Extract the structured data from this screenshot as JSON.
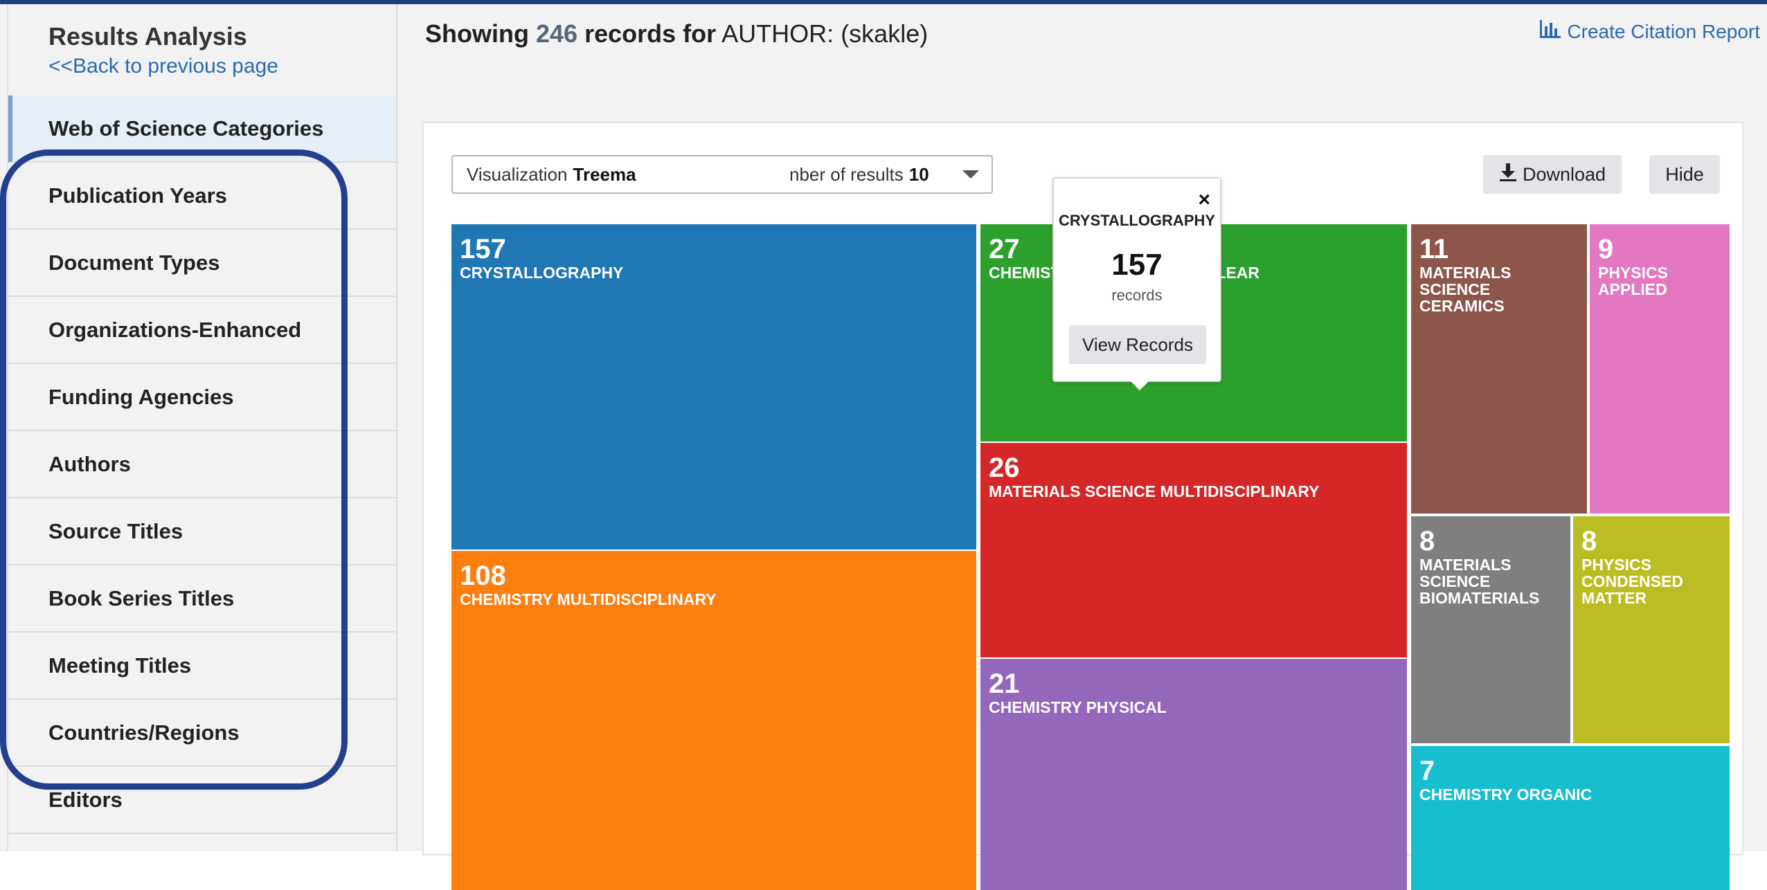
{
  "sidebar": {
    "title": "Results Analysis",
    "back_link": "<<Back to previous page",
    "items": [
      {
        "label": "Web of Science Categories"
      },
      {
        "label": "Publication Years"
      },
      {
        "label": "Document Types"
      },
      {
        "label": "Organizations-Enhanced"
      },
      {
        "label": "Funding Agencies"
      },
      {
        "label": "Authors"
      },
      {
        "label": "Source Titles"
      },
      {
        "label": "Book Series Titles"
      },
      {
        "label": "Meeting Titles"
      },
      {
        "label": "Countries/Regions"
      },
      {
        "label": "Editors"
      }
    ]
  },
  "header": {
    "showing": "Showing",
    "count": "246",
    "records_for": "records for",
    "field": "AUTHOR:",
    "query": "(skakle)",
    "citation_report": "Create Citation Report"
  },
  "controls": {
    "visualization_label": "Visualization",
    "visualization_value": "Treema",
    "number_label": "nber of results",
    "number_value": "10",
    "download": "Download",
    "hide": "Hide"
  },
  "tooltip": {
    "close": "×",
    "category": "CRYSTALLOGRAPHY",
    "count": "157",
    "unit": "records",
    "button": "View Records"
  },
  "chart_data": {
    "type": "treemap",
    "items": [
      {
        "value": 157,
        "label": "CRYSTALLOGRAPHY",
        "color": "#1f77b4"
      },
      {
        "value": 108,
        "label": "CHEMISTRY MULTIDISCIPLINARY",
        "color": "#ff7f0e"
      },
      {
        "value": 27,
        "label": "CHEMISTRY INORGANIC NUCLEAR",
        "color": "#2ca02c"
      },
      {
        "value": 26,
        "label": "MATERIALS SCIENCE MULTIDISCIPLINARY",
        "color": "#d62728"
      },
      {
        "value": 21,
        "label": "CHEMISTRY PHYSICAL",
        "color": "#9467bd"
      },
      {
        "value": 11,
        "label": "MATERIALS SCIENCE CERAMICS",
        "color": "#8c564b"
      },
      {
        "value": 9,
        "label": "PHYSICS APPLIED",
        "color": "#e377c2"
      },
      {
        "value": 8,
        "label": "MATERIALS SCIENCE BIOMATERIALS",
        "color": "#7f7f7f"
      },
      {
        "value": 8,
        "label": "PHYSICS CONDENSED MATTER",
        "color": "#bcbd22"
      },
      {
        "value": 7,
        "label": "CHEMISTRY ORGANIC",
        "color": "#17becf"
      }
    ]
  },
  "colors": {
    "highlight": "#233f8f",
    "link": "#2a6ab0"
  }
}
